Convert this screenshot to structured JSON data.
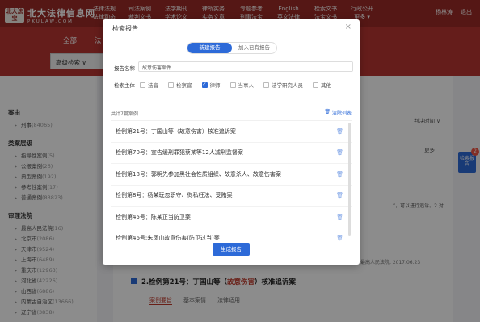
{
  "header": {
    "logo_mark": "北大法宝",
    "logo_cn": "北大法律信息网",
    "logo_en": "PKULAW.COM",
    "nav": [
      "法律法规",
      "司法案例",
      "法学期刊",
      "律所实务",
      "专题参考",
      "English",
      "检索文书",
      "行政公开"
    ],
    "nav_sub": [
      "法律动态",
      "裁判文书",
      "学术论文",
      "实务文章",
      "刑事法宝",
      "英文法律",
      "法宝文书",
      "更多 ▾"
    ],
    "user": "杨林涛",
    "logout": "退出"
  },
  "subbar": {
    "tabs": [
      "全部",
      "法"
    ],
    "advanced_search": "高级检索 ∨",
    "search_partial": "故"
  },
  "sidebar": {
    "groups": [
      {
        "title": "案由",
        "items": [
          {
            "label": "刑事",
            "count": "(84065)"
          }
        ]
      },
      {
        "title": "类案层级",
        "items": [
          {
            "label": "指导性案例",
            "count": "(5)"
          },
          {
            "label": "公报案例",
            "count": "(26)"
          },
          {
            "label": "典型案例",
            "count": "(192)"
          },
          {
            "label": "参考性案例",
            "count": "(17)"
          },
          {
            "label": "普通案例",
            "count": "(83823)"
          }
        ]
      },
      {
        "title": "审理法院",
        "items": [
          {
            "label": "最高人民法院",
            "count": "(16)"
          },
          {
            "label": "北京市",
            "count": "(2086)"
          },
          {
            "label": "天津市",
            "count": "(9524)"
          },
          {
            "label": "上海市",
            "count": "(6489)"
          },
          {
            "label": "重庆市",
            "count": "(12963)"
          },
          {
            "label": "河北省",
            "count": "(42226)"
          },
          {
            "label": "山西省",
            "count": "(6886)"
          },
          {
            "label": "内蒙古自治区",
            "count": "(13666)"
          },
          {
            "label": "辽宁省",
            "count": "(3838)"
          }
        ]
      }
    ]
  },
  "background": {
    "sort": "判决时间 ∨",
    "more": "更多",
    "case_title_prefix": "2.检例第21号：丁国山等（",
    "case_title_highlight": "故意伤害",
    "case_title_suffix": "）核准追诉案",
    "case_tabs": [
      "案例要旨",
      "基本案情",
      "法律适用"
    ],
    "snippet1": "”，可以进行追诉。2.对",
    "snippet2": "最高人民法院, 2017.06.23"
  },
  "float_button": {
    "label": "检索报告",
    "badge": "2"
  },
  "modal": {
    "title": "检索报告",
    "close": "×",
    "tabs": [
      {
        "label": "新建报告",
        "active": true
      },
      {
        "label": "加入已有报告",
        "active": false
      }
    ],
    "name_label": "报告名称",
    "name_value": "故意伤害案件",
    "role_label": "检索主体",
    "roles": [
      {
        "label": "法官",
        "checked": false
      },
      {
        "label": "检察官",
        "checked": false
      },
      {
        "label": "律师",
        "checked": true
      },
      {
        "label": "当事人",
        "checked": false
      },
      {
        "label": "法学研究人员",
        "checked": false
      },
      {
        "label": "其他",
        "checked": false
      }
    ],
    "count_text": "共计7篇案例",
    "clear_label": "清除列表",
    "cases": [
      "检例第21号：丁国山等（故意伤害）核准追诉案",
      "检例第70号：宣告缓刑罪犯蔡某等12人减刑监督案",
      "检例第18号：郭明先参加黑社会性质组织、故意杀人、故意伤害案",
      "检例第8号：杨某玩忽职守、徇私枉法、受贿案",
      "检例第45号：陈某正当防卫案",
      "检例第46号:朱凤山故意伤害(防卫过当)案"
    ],
    "generate_button": "生成报告"
  }
}
